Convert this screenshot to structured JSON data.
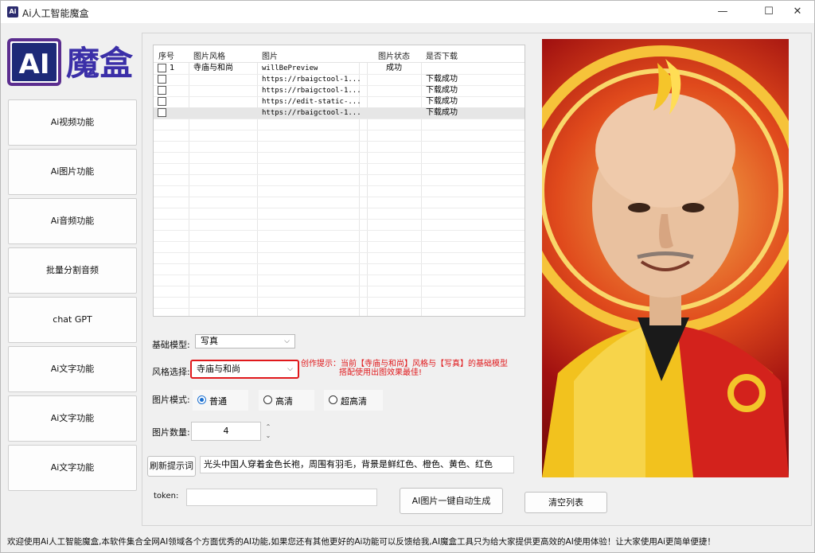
{
  "window": {
    "title": "Ai人工智能魔盒",
    "minimize": "—",
    "maximize": "☐",
    "close": "✕"
  },
  "logo": {
    "mark": "AI",
    "text": "魔盒"
  },
  "sidebar": {
    "items": [
      {
        "label": "Ai视频功能"
      },
      {
        "label": "Ai图片功能"
      },
      {
        "label": "Ai音频功能"
      },
      {
        "label": "批量分割音频"
      },
      {
        "label": "chat GPT"
      },
      {
        "label": "Ai文字功能"
      },
      {
        "label": "Ai文字功能"
      },
      {
        "label": "Ai文字功能"
      }
    ]
  },
  "table": {
    "headers": [
      "序号",
      "图片风格",
      "图片",
      "图片状态",
      "是否下载"
    ],
    "rows": [
      {
        "index": "1",
        "style": "寺庙与和尚",
        "image": "willBePreview",
        "status": "成功",
        "download": ""
      },
      {
        "index": "",
        "style": "",
        "image": "https://rbaigctool-1...",
        "status": "",
        "download": "下载成功"
      },
      {
        "index": "",
        "style": "",
        "image": "https://rbaigctool-1...",
        "status": "",
        "download": "下载成功"
      },
      {
        "index": "",
        "style": "",
        "image": "https://edit-static-...",
        "status": "",
        "download": "下载成功"
      },
      {
        "index": "",
        "style": "",
        "image": "https://rbaigctool-1...",
        "status": "",
        "download": "下载成功"
      }
    ]
  },
  "form": {
    "model_label": "基础模型:",
    "model_value": "写真",
    "style_label": "风格选择:",
    "style_value": "寺庙与和尚",
    "hint_line1": "创作提示：当前【寺庙与和尚】风格与【写真】的基础模型",
    "hint_line2": "搭配使用出图效果最佳!",
    "mode_label": "图片模式:",
    "modes": [
      "普通",
      "高清",
      "超高清"
    ],
    "mode_selected": "普通",
    "count_label": "图片数量:",
    "count_value": "4",
    "refresh_button": "刷新提示词",
    "prompt_value": "光头中国人穿着金色长袍，周围有羽毛，背景是鲜红色、橙色、黄色、红色",
    "token_label": "token:",
    "token_value": "",
    "generate_button": "AI图片一键自动生成",
    "clear_button": "清空列表"
  },
  "status_bar": "欢迎使用Ai人工智能魔盒,本软件集合全网AI领域各个方面优秀的AI功能,如果您还有其他更好的Ai功能可以反馈给我,AI魔盒工具只为给大家提供更高效的AI使用体验！让大家使用Ai更简单便捷！",
  "colors": {
    "accent_red": "#e0181b",
    "radio_blue": "#1a6fd0",
    "logo_purple": "#5b2d8f"
  },
  "icons": {
    "dropdown": "chevron-down-icon",
    "spin": "up-down-arrows-icon"
  }
}
